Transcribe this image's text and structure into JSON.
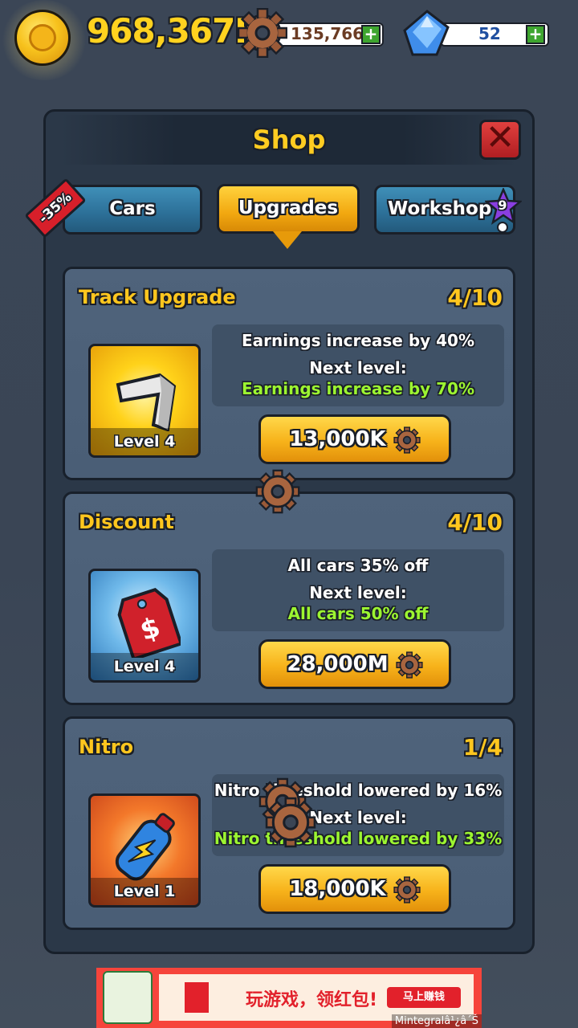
{
  "top_bar": {
    "coins": "968,367K",
    "gears": "135,766",
    "gems": "52",
    "add_label": "+"
  },
  "shop": {
    "title": "Shop",
    "close_label": "✕",
    "discount_tag": "-35%",
    "tabs": [
      {
        "label": "Cars",
        "active": false
      },
      {
        "label": "Upgrades",
        "active": true
      },
      {
        "label": "Workshop",
        "active": false,
        "badge": "9"
      }
    ]
  },
  "upgrades": [
    {
      "name": "Track Upgrade",
      "progress": "4/10",
      "level_label": "Level 4",
      "current_effect": "Earnings increase by 40%",
      "next_label": "Next level:",
      "next_effect": "Earnings increase by 70%",
      "price": "13,000K"
    },
    {
      "name": "Discount",
      "progress": "4/10",
      "level_label": "Level 4",
      "current_effect": "All cars 35% off",
      "next_label": "Next level:",
      "next_effect": "All cars 50% off",
      "price": "28,000M"
    },
    {
      "name": "Nitro",
      "progress": "1/4",
      "level_label": "Level 1",
      "current_effect": "Nitro threshold lowered by 16%",
      "next_label": "Next level:",
      "next_effect": "Nitro threshold lowered by 33%",
      "price": "18,000K"
    }
  ],
  "ad": {
    "text": "玩游戏，领红包!",
    "button": "马上赚钱",
    "attribution": "Mintegralâ¹¿â´Š"
  },
  "colors": {
    "gold_text": "#ffc61e",
    "green_text": "#9cf531",
    "panel": "#2b3848",
    "card": "#4f637b",
    "tab_blue": "#2c6f97",
    "tab_gold": "#f2a810"
  },
  "icons": [
    "coin-icon",
    "gear-icon",
    "gem-icon",
    "plus-icon",
    "close-icon",
    "price-tag-icon",
    "star-badge-icon",
    "track-icon",
    "sale-tag-icon",
    "nitro-bottle-icon"
  ]
}
